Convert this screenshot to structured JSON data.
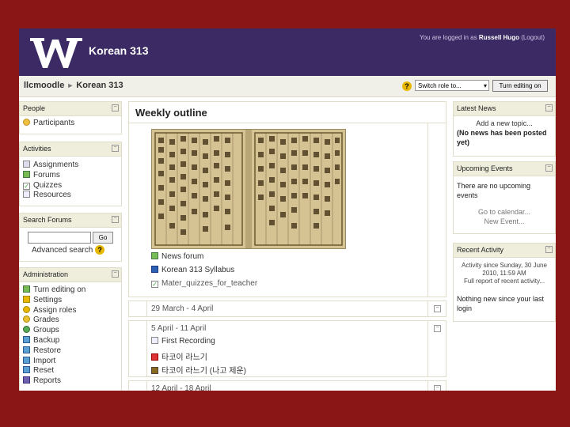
{
  "header": {
    "course_title": "Korean 313",
    "login_prefix": "You are logged in as ",
    "login_user": "Russell Hugo",
    "logout": " (Logout)"
  },
  "navbar": {
    "crumb_root": "llcmoodle",
    "crumb_sep": "►",
    "crumb_current": "Korean 313",
    "role_select": "Switch role to...",
    "edit_button": "Turn editing on"
  },
  "people": {
    "title": "People",
    "items": [
      "Participants"
    ]
  },
  "activities": {
    "title": "Activities",
    "items": [
      "Assignments",
      "Forums",
      "Quizzes",
      "Resources"
    ]
  },
  "search": {
    "title": "Search Forums",
    "go": "Go",
    "advanced": "Advanced search"
  },
  "admin": {
    "title": "Administration",
    "items": [
      "Turn editing on",
      "Settings",
      "Assign roles",
      "Grades",
      "Groups",
      "Backup",
      "Restore",
      "Import",
      "Reset",
      "Reports"
    ]
  },
  "main": {
    "weekly_title": "Weekly outline",
    "resources": [
      "News forum",
      "Korean 313 Syllabus",
      "Mater_quizzes_for_teacher"
    ],
    "weeks": [
      {
        "dates": "29 March - 4 April",
        "items": []
      },
      {
        "dates": "5 April - 11 April",
        "items": [
          "First Recording",
          "타코이 라느기",
          "타코이 라느기 (나고 제운)"
        ]
      },
      {
        "dates": "12 April - 18 April",
        "items": []
      }
    ]
  },
  "latest_news": {
    "title": "Latest News",
    "add": "Add a new topic...",
    "none": "(No news has been posted yet)"
  },
  "upcoming": {
    "title": "Upcoming Events",
    "none": "There are no upcoming events",
    "calendar": "Go to calendar...",
    "new_event": "New Event..."
  },
  "recent": {
    "title": "Recent Activity",
    "since": "Activity since Sunday, 30 June 2010, 11:59 AM",
    "full": "Full report of recent activity...",
    "nothing": "Nothing new since your last login"
  },
  "colors": {
    "background": "#8a1616",
    "header": "#3b2a64"
  }
}
